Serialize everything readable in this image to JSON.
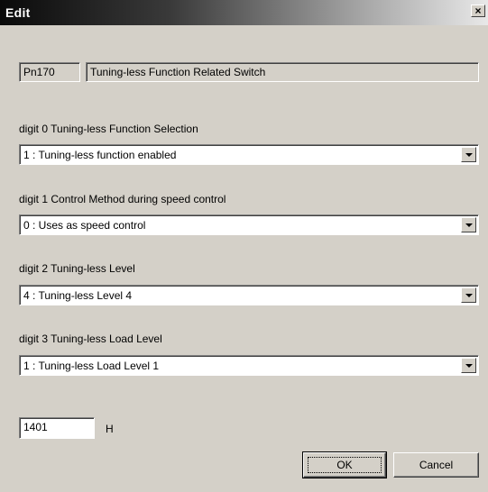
{
  "window": {
    "title": "Edit",
    "close_glyph": "×"
  },
  "parameter": {
    "number": "Pn170",
    "name": "Tuning-less Function Related Switch"
  },
  "digits": [
    {
      "label": "digit 0  Tuning-less Function Selection",
      "selected": "1 : Tuning-less function enabled"
    },
    {
      "label": "digit 1  Control Method during speed control",
      "selected": "0 : Uses as speed control"
    },
    {
      "label": "digit 2  Tuning-less Level",
      "selected": "4 : Tuning-less Level 4"
    },
    {
      "label": "digit 3  Tuning-less Load Level",
      "selected": "1 : Tuning-less Load Level 1"
    }
  ],
  "value": {
    "hex": "1401",
    "suffix": "H"
  },
  "buttons": {
    "ok": "OK",
    "cancel": "Cancel"
  },
  "colors": {
    "dialog_bg": "#d4d0c8",
    "title_bar_start": "#0a0a0a",
    "title_bar_end": "#e8e8e8"
  }
}
